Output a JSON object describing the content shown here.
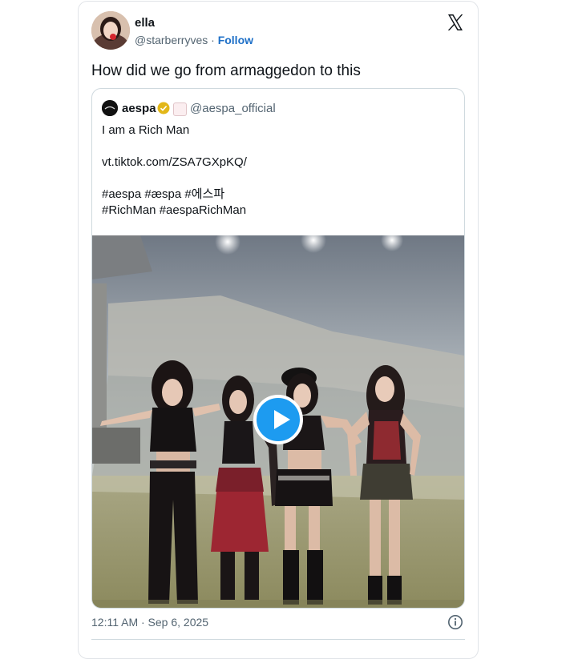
{
  "author": {
    "name": "ella",
    "handle": "@starberryves",
    "separator": " · ",
    "follow_label": "Follow",
    "avatar_icon": "profile-photo-avatar"
  },
  "tweet": {
    "text": "How did we go from armaggedon to this",
    "timestamp": "12:11 AM · Sep 6, 2025"
  },
  "quoted": {
    "name": "aespa",
    "handle": "@aespa_official",
    "verified_color": "#e2b719",
    "lines": [
      "I am a Rich Man",
      "",
      "vt.tiktok.com/ZSA7GXpKQ/",
      "",
      "#aespa #æspa #에스파",
      "#RichMan #aespaRichMan"
    ],
    "media": {
      "type": "video",
      "play_icon": "play-icon",
      "play_color": "#1d9bf0"
    }
  },
  "icons": {
    "brand": "x-logo-icon",
    "info": "info-icon"
  },
  "colors": {
    "secondary_text": "#536471",
    "link": "#1d6fc7",
    "border": "#cfd9de"
  }
}
